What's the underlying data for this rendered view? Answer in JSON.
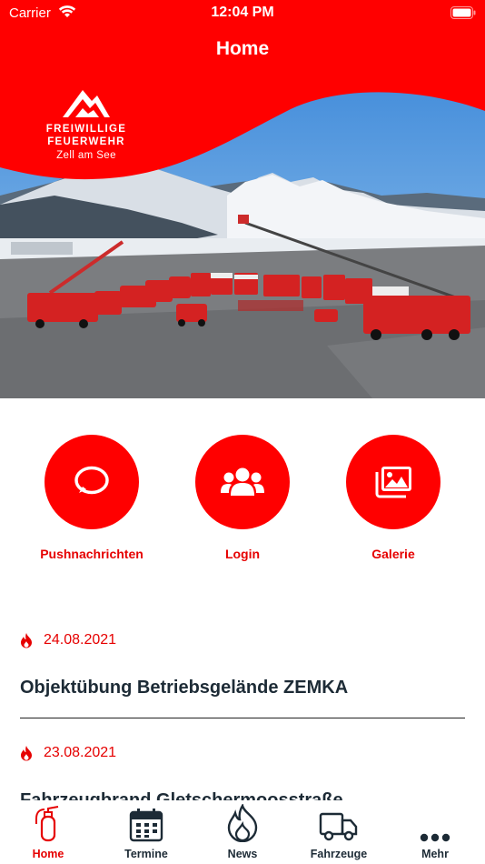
{
  "status": {
    "carrier": "Carrier",
    "time": "12:04 PM"
  },
  "header": {
    "title": "Home"
  },
  "logo": {
    "line1": "FREIWILLIGE",
    "line2": "FEUERWEHR",
    "line3": "Zell am See"
  },
  "quick_actions": [
    {
      "label": "Pushnachrichten",
      "icon": "chat-bubble-icon"
    },
    {
      "label": "Login",
      "icon": "users-icon"
    },
    {
      "label": "Galerie",
      "icon": "gallery-icon"
    }
  ],
  "news": [
    {
      "date": "24.08.2021",
      "title": "Objektübung Betriebsgelände ZEMKA"
    },
    {
      "date": "23.08.2021",
      "title": "Fahrzeugbrand Gletschermoosstraße"
    }
  ],
  "tabs": [
    {
      "label": "Home",
      "icon": "fire-extinguisher-icon",
      "active": true
    },
    {
      "label": "Termine",
      "icon": "calendar-icon",
      "active": false
    },
    {
      "label": "News",
      "icon": "flame-icon",
      "active": false
    },
    {
      "label": "Fahrzeuge",
      "icon": "truck-icon",
      "active": false
    },
    {
      "label": "Mehr",
      "icon": "more-dots-icon",
      "active": false
    }
  ],
  "colors": {
    "brand_red": "#ff0000",
    "text_dark": "#1d2b36"
  }
}
